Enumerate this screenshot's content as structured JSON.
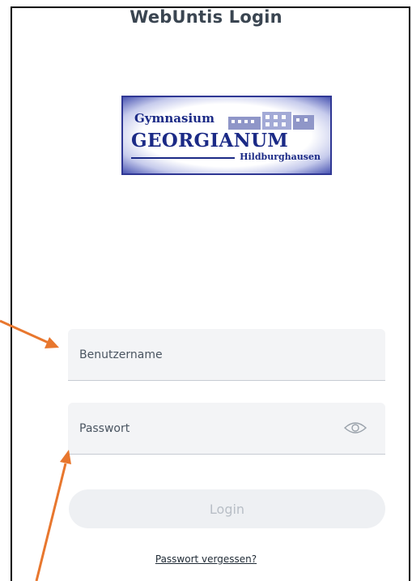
{
  "page": {
    "title": "WebUntis Login"
  },
  "logo": {
    "line1": "Gymnasium",
    "line2": "GEORGIANUM",
    "line3": "Hildburghausen"
  },
  "form": {
    "username_placeholder": "Benutzername",
    "password_placeholder": "Passwort",
    "login_label": "Login",
    "forgot_label": "Passwort vergessen?"
  },
  "colors": {
    "annotation_arrow": "#e8772e",
    "logo_blue": "#1b2a86",
    "title_text": "#3a4551"
  }
}
